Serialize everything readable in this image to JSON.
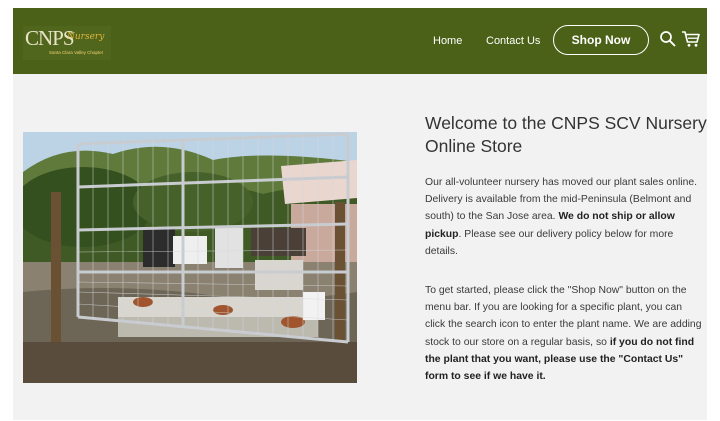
{
  "header": {
    "logo_text": "CNPS",
    "logo_script": "Nursery",
    "logo_sub": "Santa Clara Valley Chapter",
    "nav": {
      "home": "Home",
      "contact": "Contact Us",
      "shop": "Shop Now"
    },
    "icons": [
      "search-icon",
      "cart-icon"
    ]
  },
  "hero": {
    "image_alt": "Nursery gate with plants"
  },
  "content": {
    "title": "Welcome to the CNPS SCV Nursery Online Store",
    "p1_a": "Our all-volunteer nursery has moved our plant sales online. Delivery is available from the mid-Peninsula (Belmont and south) to the San Jose area. ",
    "p1_b": "We do not ship or allow pickup",
    "p1_c": ". Please see our delivery policy below for more details.",
    "p2_a": "To get started, please click the \"Shop Now\" button on the menu bar. If you are looking for a specific plant, you can click the search icon to enter the plant name. We are adding stock to our store on a regular basis, so ",
    "p2_b": "if you do not find the plant that you want, please use the \"Contact Us\" form to see if we have it."
  },
  "colors": {
    "header_bg": "#4b6117",
    "page_bg": "#f2f2f2",
    "text": "#333333"
  }
}
